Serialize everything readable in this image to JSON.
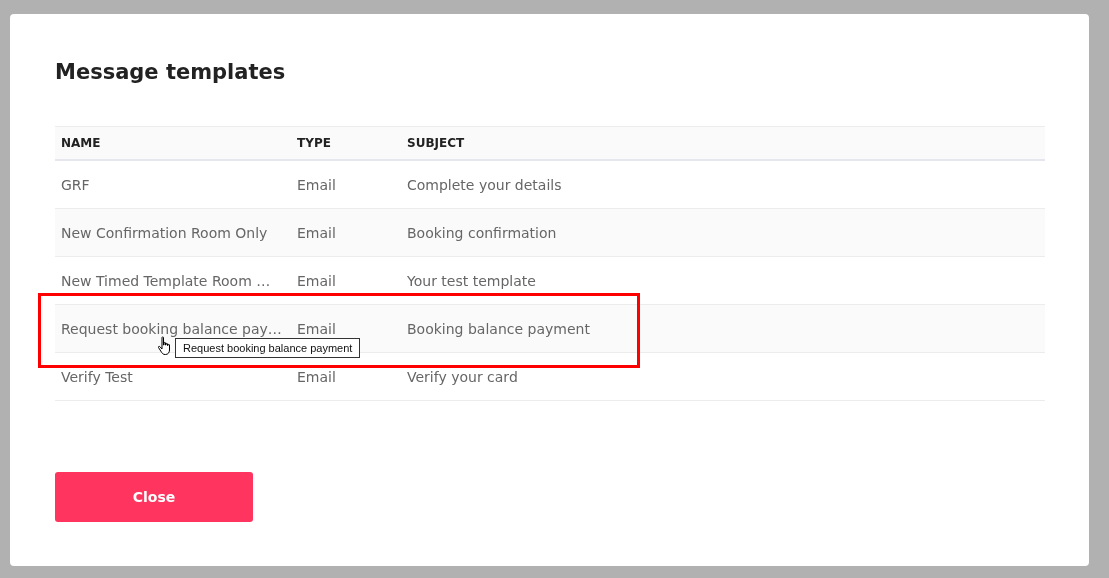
{
  "dialog": {
    "title": "Message templates",
    "table": {
      "columns": [
        "NAME",
        "TYPE",
        "SUBJECT"
      ],
      "rows": [
        {
          "name": "GRF",
          "type": "Email",
          "subject": "Complete your details",
          "annotated": false
        },
        {
          "name": "New Confirmation Room Only",
          "type": "Email",
          "subject": "Booking confirmation",
          "annotated": false
        },
        {
          "name": "New Timed Template Room …",
          "type": "Email",
          "subject": "Your test template",
          "annotated": false
        },
        {
          "name": "Request booking balance pay…",
          "type": "Email",
          "subject": "Booking balance payment",
          "annotated": true,
          "tooltip": "Request booking balance payment"
        },
        {
          "name": "Verify Test",
          "type": "Email",
          "subject": "Verify your card",
          "annotated": false
        }
      ]
    },
    "close_button": "Close"
  }
}
